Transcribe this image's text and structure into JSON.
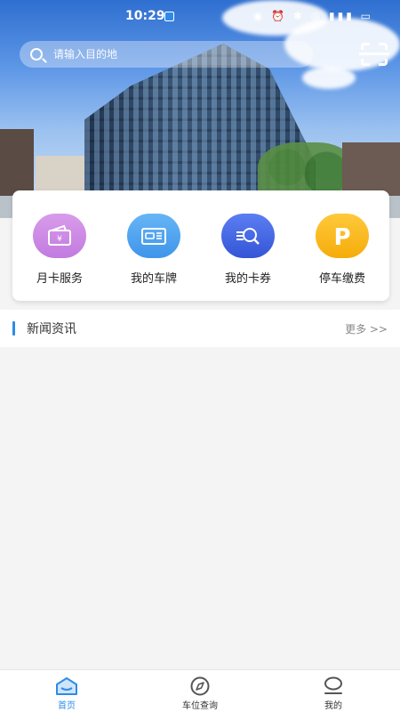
{
  "status_bar": {
    "time": "10:29"
  },
  "search": {
    "placeholder": "请输入目的地"
  },
  "menu": [
    {
      "label": "月卡服务",
      "icon": "wallet-icon",
      "color": "#c27be0"
    },
    {
      "label": "我的车牌",
      "icon": "plate-icon",
      "color": "#3f95ea"
    },
    {
      "label": "我的卡券",
      "icon": "coupon-search-icon",
      "color": "#3455d6"
    },
    {
      "label": "停车缴费",
      "icon": "parking-icon",
      "color": "#f5ac0a"
    }
  ],
  "news": {
    "title": "新闻资讯",
    "more": "更多 >>"
  },
  "bottom_nav": [
    {
      "label": "首页",
      "icon": "home-icon",
      "active": true
    },
    {
      "label": "车位查询",
      "icon": "compass-icon",
      "active": false
    },
    {
      "label": "我的",
      "icon": "user-icon",
      "active": false
    }
  ],
  "colors": {
    "accent": "#2d8be8"
  }
}
